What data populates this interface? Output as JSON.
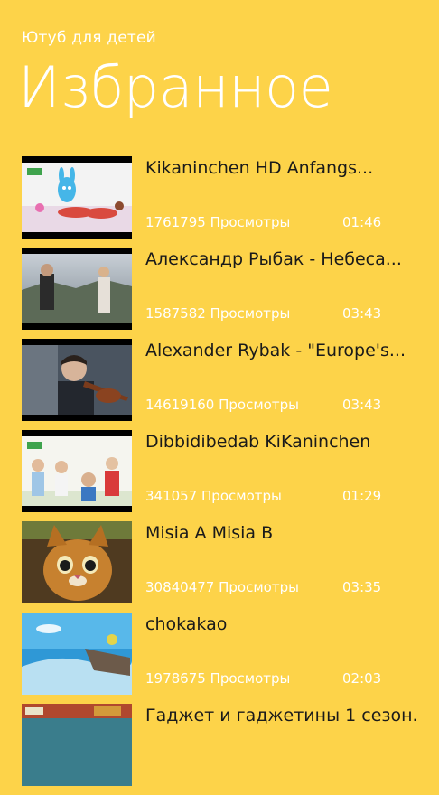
{
  "app": {
    "title": "Ютуб для детей"
  },
  "page": {
    "title": "Избранное"
  },
  "videos": [
    {
      "title": "Kikaninchen HD Anfangs...",
      "views": "1761795 Просмотры",
      "duration": "01:46"
    },
    {
      "title": "Александр Рыбак - Небеса...",
      "views": "1587582 Просмотры",
      "duration": "03:43"
    },
    {
      "title": "Alexander Rybak - \"Europe's...",
      "views": "14619160 Просмотры",
      "duration": "03:43"
    },
    {
      "title": "Dibbidibedab  KiKaninchen",
      "views": "341057 Просмотры",
      "duration": "01:29"
    },
    {
      "title": "Misia A  Misia B",
      "views": "30840477 Просмотры",
      "duration": "03:35"
    },
    {
      "title": "chokakao",
      "views": "1978675 Просмотры",
      "duration": "02:03"
    },
    {
      "title": "Гаджет и гаджетины 1 сезон...",
      "views": "",
      "duration": ""
    }
  ]
}
